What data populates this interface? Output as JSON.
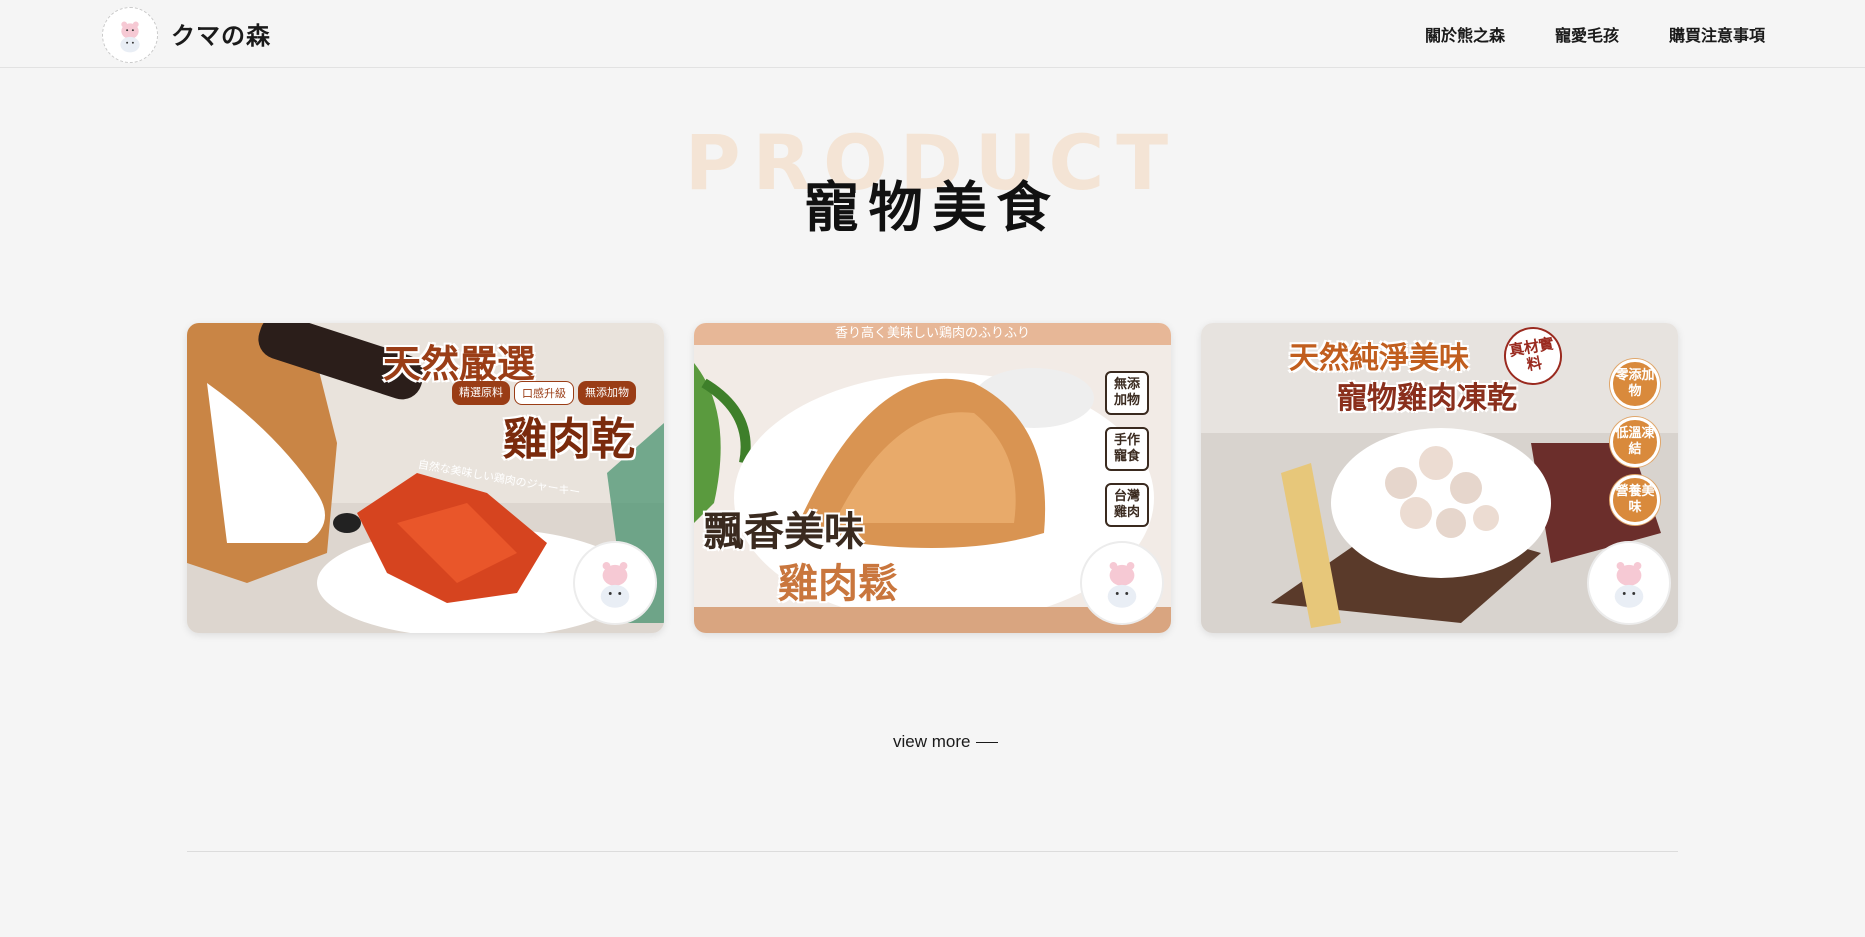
{
  "header": {
    "brand": "クマの森",
    "nav": [
      {
        "label": "關於熊之森"
      },
      {
        "label": "寵愛毛孩"
      },
      {
        "label": "購買注意事項"
      }
    ]
  },
  "section": {
    "bg_word": "PRODUCT",
    "title": "寵物美食"
  },
  "cards": [
    {
      "title": "天然嚴選",
      "subtitle": "雞肉乾",
      "tags": [
        "精選原料",
        "口感升級",
        "無添加物"
      ],
      "jp_text": "自然な美味しい鶏肉のジャーキー"
    },
    {
      "band_text": "香り高く美味しい鶏肉のふりふり",
      "title": "飄香美味",
      "subtitle": "雞肉鬆",
      "badges": [
        "無添加物",
        "手作寵食",
        "台灣雞肉"
      ]
    },
    {
      "title": "天然純淨美味",
      "subtitle": "寵物雞肉凍乾",
      "stamp": "真材實料",
      "badges": [
        "零添加物",
        "低溫凍結",
        "營養美味"
      ]
    }
  ],
  "view_more": "view more",
  "colors": {
    "background": "#f5f5f5",
    "accent_orange": "#f3c79a",
    "brown": "#9a3d16"
  }
}
